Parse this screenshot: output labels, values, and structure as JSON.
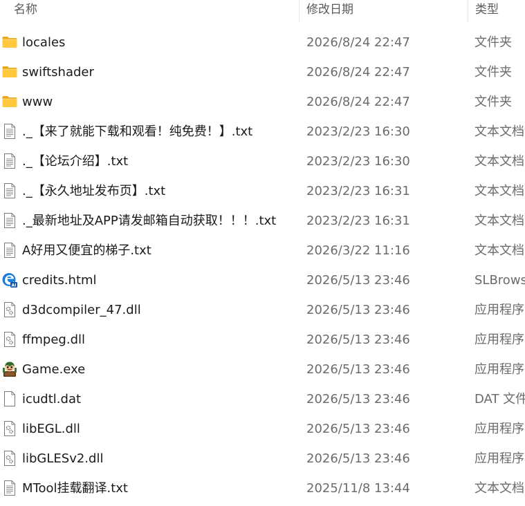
{
  "header": {
    "name_label": "名称",
    "date_label": "修改日期",
    "type_label": "类型"
  },
  "files": [
    {
      "name": "locales",
      "date": "2026/8/24 22:47",
      "type": "文件夹",
      "icon": "folder-icon"
    },
    {
      "name": "swiftshader",
      "date": "2026/8/24 22:47",
      "type": "文件夹",
      "icon": "folder-icon"
    },
    {
      "name": "www",
      "date": "2026/8/24 22:47",
      "type": "文件夹",
      "icon": "folder-icon"
    },
    {
      "name": "._【来了就能下载和观看！纯免费！】.txt",
      "date": "2023/2/23 16:30",
      "type": "文本文档",
      "icon": "text-file-icon"
    },
    {
      "name": "._【论坛介绍】.txt",
      "date": "2023/2/23 16:30",
      "type": "文本文档",
      "icon": "text-file-icon"
    },
    {
      "name": "._【永久地址发布页】.txt",
      "date": "2023/2/23 16:31",
      "type": "文本文档",
      "icon": "text-file-icon"
    },
    {
      "name": "._最新地址及APP请发邮箱自动获取！！！.txt",
      "date": "2023/2/23 16:31",
      "type": "文本文档",
      "icon": "text-file-icon"
    },
    {
      "name": "A好用又便宜的梯子.txt",
      "date": "2026/3/22 11:16",
      "type": "文本文档",
      "icon": "text-file-icon"
    },
    {
      "name": "credits.html",
      "date": "2026/5/13 23:46",
      "type": "SLBrowser",
      "icon": "browser-html-icon"
    },
    {
      "name": "d3dcompiler_47.dll",
      "date": "2026/5/13 23:46",
      "type": "应用程序扩展",
      "icon": "dll-file-icon"
    },
    {
      "name": "ffmpeg.dll",
      "date": "2026/5/13 23:46",
      "type": "应用程序扩展",
      "icon": "dll-file-icon"
    },
    {
      "name": "Game.exe",
      "date": "2026/5/13 23:46",
      "type": "应用程序",
      "icon": "game-exe-icon"
    },
    {
      "name": "icudtl.dat",
      "date": "2026/5/13 23:46",
      "type": "DAT 文件",
      "icon": "blank-file-icon"
    },
    {
      "name": "libEGL.dll",
      "date": "2026/5/13 23:46",
      "type": "应用程序扩展",
      "icon": "dll-file-icon"
    },
    {
      "name": "libGLESv2.dll",
      "date": "2026/5/13 23:46",
      "type": "应用程序扩展",
      "icon": "dll-file-icon"
    },
    {
      "name": "MTool挂载翻译.txt",
      "date": "2025/11/8 13:44",
      "type": "文本文档",
      "icon": "text-file-icon"
    }
  ]
}
